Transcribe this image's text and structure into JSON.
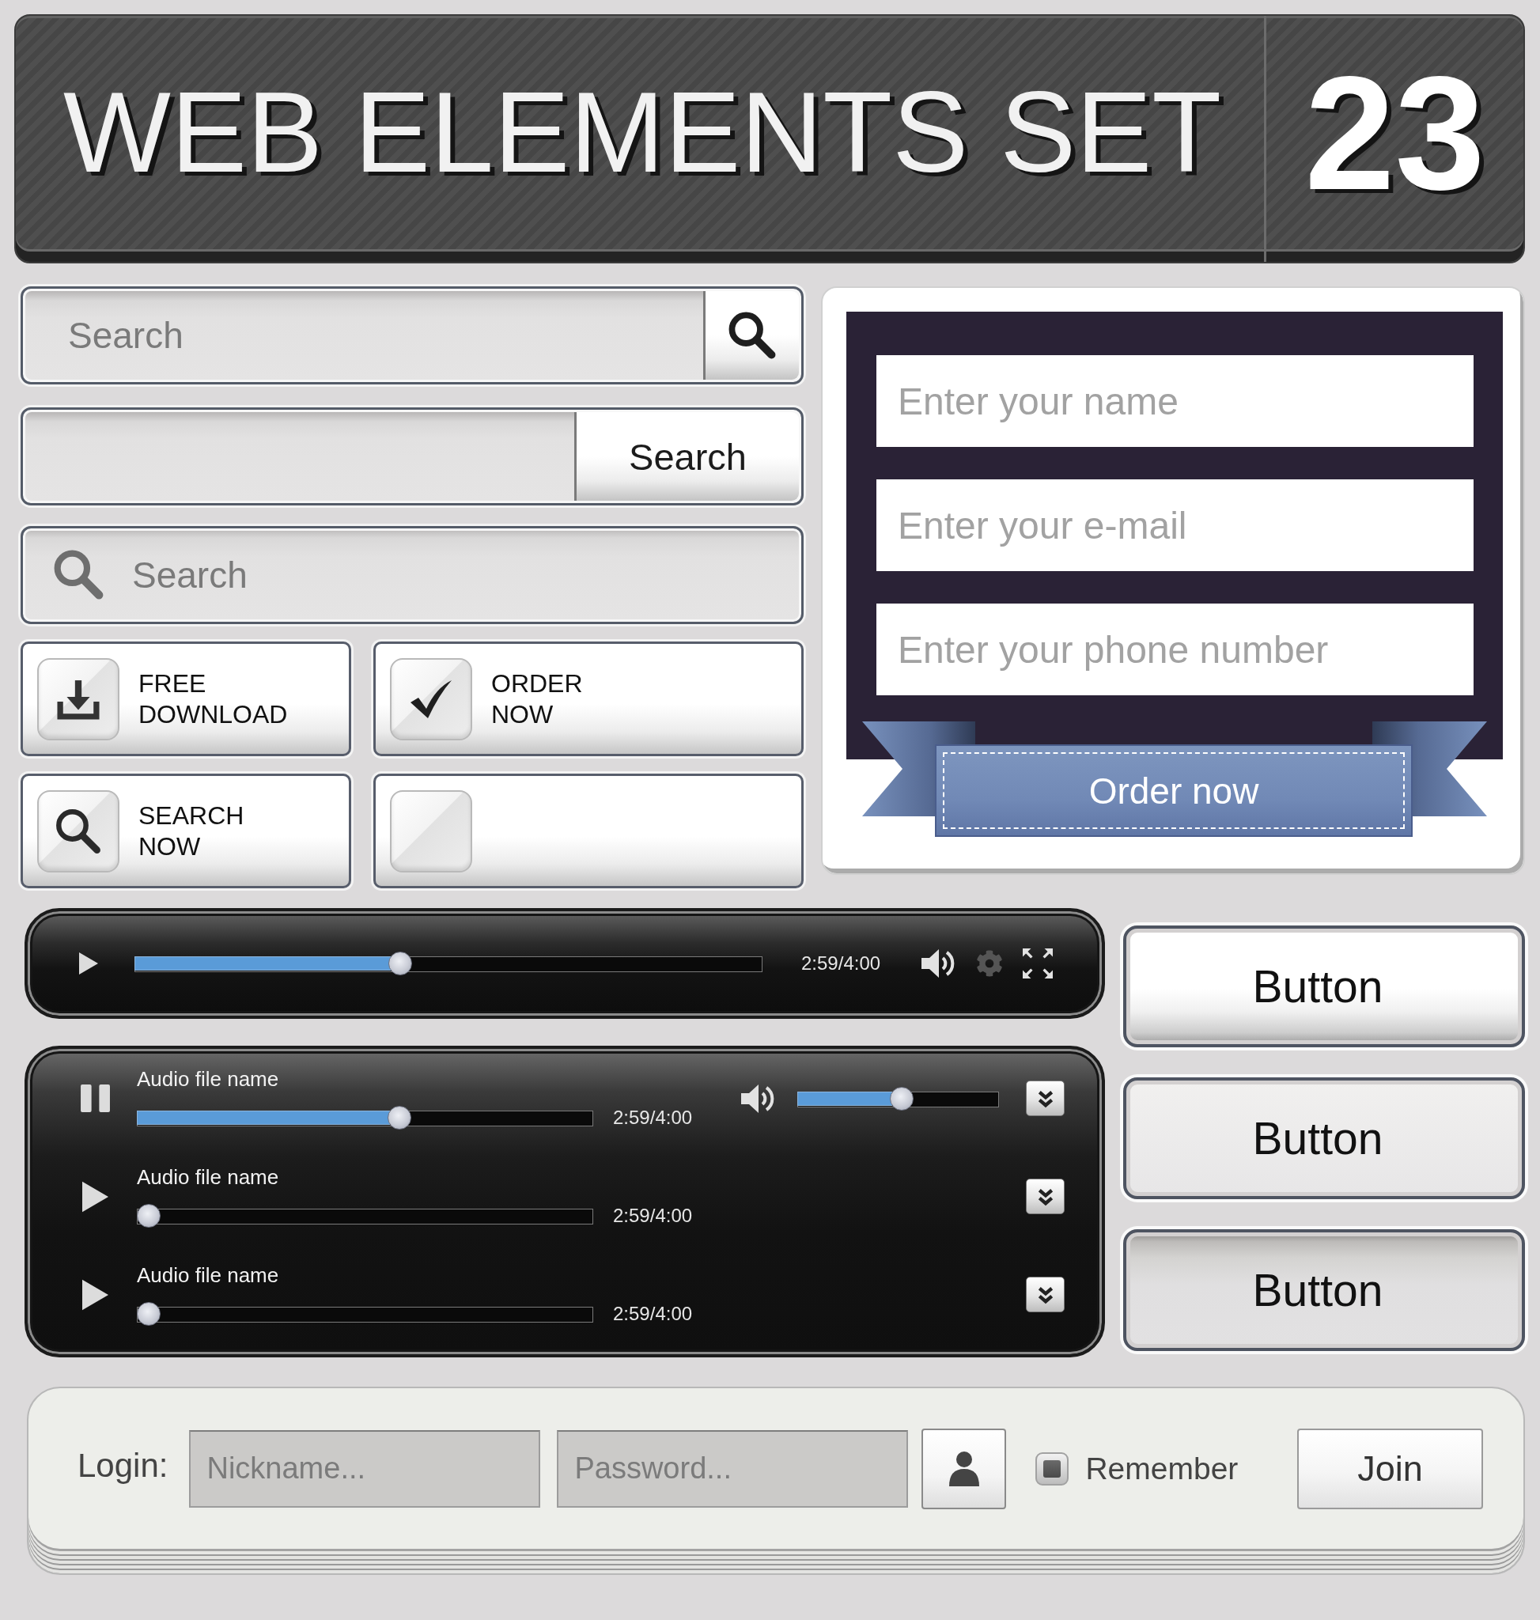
{
  "header": {
    "title": "WEB ELEMENTS SET",
    "number": "23"
  },
  "search_bars": [
    {
      "kind": "icon_button",
      "placeholder": "Search"
    },
    {
      "kind": "text_button",
      "button": "Search"
    },
    {
      "kind": "leading_icon",
      "placeholder": "Search"
    }
  ],
  "tiles": [
    {
      "kind": "download",
      "label": "FREE DOWNLOAD"
    },
    {
      "kind": "check",
      "label": "ORDER NOW"
    },
    {
      "kind": "search",
      "label": "SEARCH NOW"
    },
    {
      "kind": "blank"
    }
  ],
  "order_form": {
    "fields": [
      {
        "placeholder": "Enter your name"
      },
      {
        "placeholder": "Enter your e-mail"
      },
      {
        "placeholder": "Enter your phone number"
      }
    ],
    "button": "Order now"
  },
  "video_player": {
    "playing": false,
    "level": 0.42,
    "time": "2:59/4:00"
  },
  "audio_player": {
    "volume": {
      "level": 0.52
    },
    "tracks": [
      {
        "name": "Audio file name",
        "playing": true,
        "level": 0.58,
        "time": "2:59/4:00"
      },
      {
        "name": "Audio file name",
        "playing": false,
        "level": 0,
        "time": "2:59/4:00"
      },
      {
        "name": "Audio file name",
        "playing": false,
        "level": 0,
        "time": "2:59/4:00"
      }
    ]
  },
  "buttons": [
    {
      "kind": "raised",
      "label": "Button"
    },
    {
      "kind": "flat",
      "label": "Button"
    },
    {
      "kind": "pressed",
      "label": "Button"
    }
  ],
  "login": {
    "label": "Login:",
    "fields": [
      {
        "placeholder": "Nickname..."
      },
      {
        "placeholder": "Password..."
      }
    ],
    "remember": {
      "label": "Remember",
      "checked": true
    },
    "button": "Join"
  }
}
